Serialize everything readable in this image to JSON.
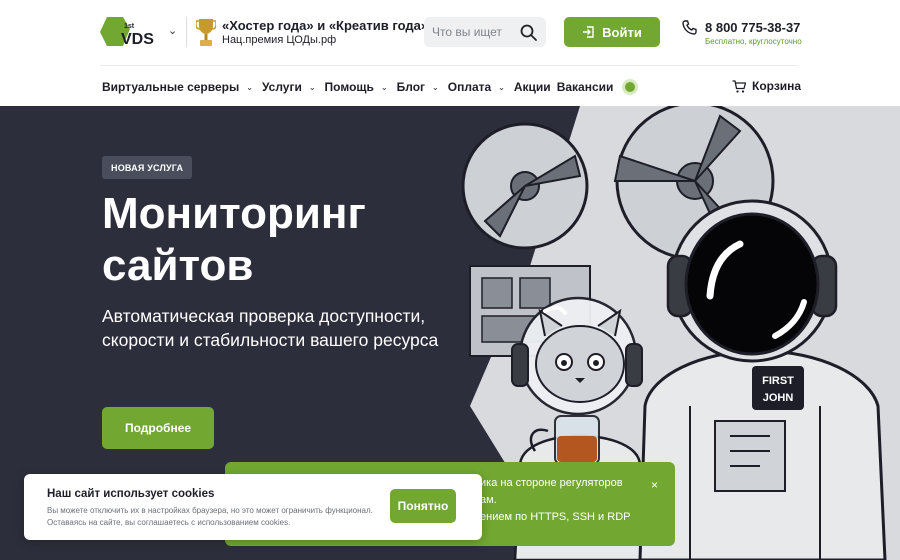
{
  "header": {
    "logo": {
      "brand": "VDS",
      "sup": "1st",
      "color": "#72a831"
    },
    "award": {
      "title": "«Хостер года» и «Креатив года»",
      "subtitle": "Нац.премия ЦОДы.рф",
      "icon": "trophy-icon"
    },
    "search": {
      "placeholder": "Что вы ищет",
      "icon": "search-icon"
    },
    "login": {
      "label": "Войти",
      "icon": "login-icon"
    },
    "phone": {
      "number": "8 800 775-38-37",
      "note": "Бесплатно, круглосуточно",
      "icon": "phone-icon"
    }
  },
  "nav": {
    "items": [
      {
        "label": "Виртуальные серверы",
        "dropdown": true
      },
      {
        "label": "Услуги",
        "dropdown": true
      },
      {
        "label": "Помощь",
        "dropdown": true
      },
      {
        "label": "Блог",
        "dropdown": true
      },
      {
        "label": "Оплата",
        "dropdown": true
      },
      {
        "label": "Акции",
        "dropdown": false
      },
      {
        "label": "Вакансии",
        "dropdown": false
      }
    ],
    "cart_label": "Корзина",
    "chevron": "⌄"
  },
  "hero": {
    "badge": "НОВАЯ УСЛУГА",
    "title": "Мониторинг сайтов",
    "subtitle": "Автоматическая проверка доступности, скорости и стабильности вашего ресурса",
    "button": "Подробнее",
    "badge_text_on_suit": "FIRST JOHN",
    "colors": {
      "background": "#2c2e3b",
      "accent": "#72a831"
    }
  },
  "notice": {
    "lines": [
      "ика на стороне регуляторов",
      "ам.",
      "ением по HTTPS, SSH и RDP"
    ],
    "close": "×"
  },
  "cookie": {
    "title": "Наш сайт использует cookies",
    "text": "Вы можете отключить их в настройках браузера, но это может ограничить функционал. Оставаясь на сайте, вы соглашаетесь с использованием cookies.",
    "button": "Понятно"
  }
}
